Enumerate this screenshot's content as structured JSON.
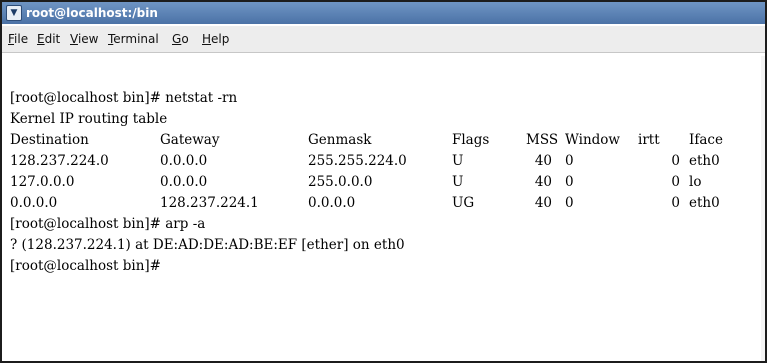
{
  "window": {
    "title": "root@localhost:/bin",
    "icon": "terminal-menu-icon"
  },
  "menu": [
    {
      "mnemonic": "F",
      "rest": "ile"
    },
    {
      "mnemonic": "E",
      "rest": "dit"
    },
    {
      "mnemonic": "V",
      "rest": "iew"
    },
    {
      "mnemonic": "T",
      "rest": "erminal"
    },
    {
      "mnemonic": "G",
      "rest": "o"
    },
    {
      "mnemonic": "H",
      "rest": "elp"
    }
  ],
  "terminal": {
    "cmd1": "[root@localhost bin]# netstat -rn",
    "table_title": "Kernel IP routing table",
    "headers": [
      "Destination",
      "Gateway",
      "Genmask",
      "Flags",
      "MSS",
      "Window",
      "irtt",
      "Iface"
    ],
    "routes": [
      {
        "dest": "128.237.224.0",
        "gw": "0.0.0.0",
        "mask": "255.255.224.0",
        "flags": "U",
        "mss": "40",
        "win": "0",
        "irtt": "0",
        "iface": "eth0"
      },
      {
        "dest": "127.0.0.0",
        "gw": "0.0.0.0",
        "mask": "255.0.0.0",
        "flags": "U",
        "mss": "40",
        "win": "0",
        "irtt": "0",
        "iface": "lo"
      },
      {
        "dest": "0.0.0.0",
        "gw": "128.237.224.1",
        "mask": "0.0.0.0",
        "flags": "UG",
        "mss": "40",
        "win": "0",
        "irtt": "0",
        "iface": "eth0"
      }
    ],
    "cmd2": "[root@localhost bin]# arp -a",
    "arp_line": "? (128.237.224.1) at DE:AD:DE:AD:BE:EF [ether] on eth0",
    "prompt": "[root@localhost bin]#"
  }
}
